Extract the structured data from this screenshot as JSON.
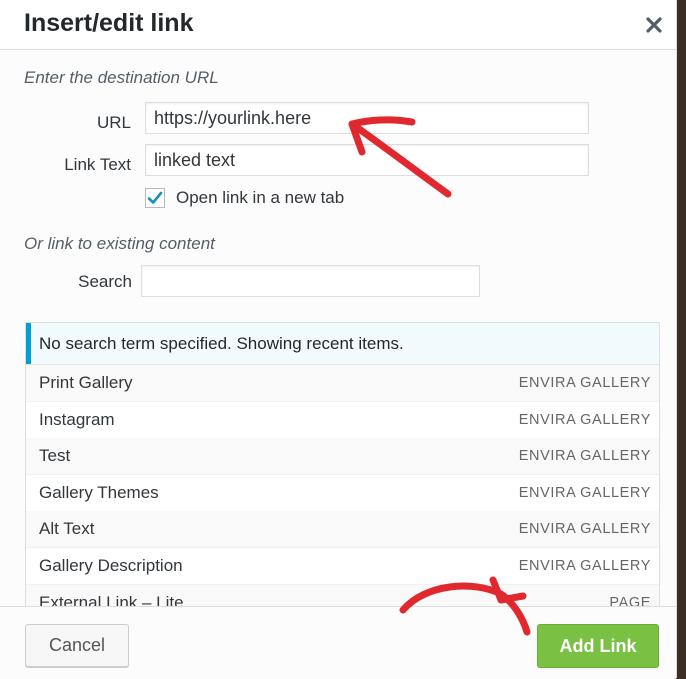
{
  "dialog": {
    "title": "Insert/edit link",
    "close_icon": "close-icon"
  },
  "url_section": {
    "hint": "Enter the destination URL",
    "url_label": "URL",
    "url_value": "https://yourlink.here",
    "link_text_label": "Link Text",
    "link_text_value": "linked text",
    "new_tab_label": "Open link in a new tab",
    "new_tab_checked": true
  },
  "search_section": {
    "hint": "Or link to existing content",
    "search_label": "Search",
    "search_value": ""
  },
  "results": {
    "notice": "No search term specified. Showing recent items.",
    "items": [
      {
        "title": "Print Gallery",
        "type": "ENVIRA GALLERY"
      },
      {
        "title": "Instagram",
        "type": "ENVIRA GALLERY"
      },
      {
        "title": "Test",
        "type": "ENVIRA GALLERY"
      },
      {
        "title": "Gallery Themes",
        "type": "ENVIRA GALLERY"
      },
      {
        "title": "Alt Text",
        "type": "ENVIRA GALLERY"
      },
      {
        "title": "Gallery Description",
        "type": "ENVIRA GALLERY"
      },
      {
        "title": "External Link – Lite",
        "type": "PAGE"
      }
    ]
  },
  "footer": {
    "cancel_label": "Cancel",
    "add_label": "Add Link"
  },
  "colors": {
    "accent_blue": "#00a0d2",
    "add_button_green": "#7ac143",
    "annotation_red": "#e0282e"
  }
}
